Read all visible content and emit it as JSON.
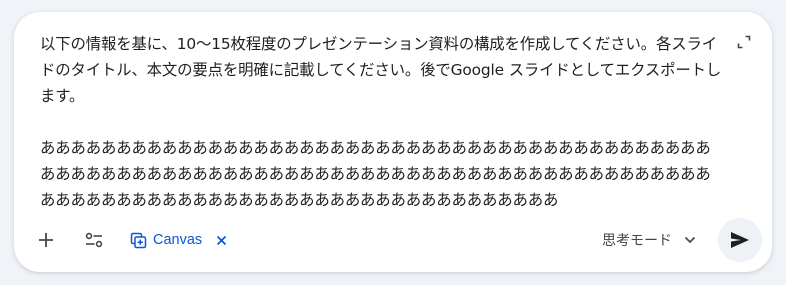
{
  "prompt": {
    "text": "以下の情報を基に、10〜15枚程度のプレゼンテーション資料の構成を作成してください。各スライドのタイトル、本文の要点を明確に記載してください。後でGoogle スライドとしてエクスポートします。\n\nああああああああああああああああああああああああああああああああああああああああああああああああああああああああああああああああああああああああああああああああああああああああああああああああああああああああああああああああああああああああああ"
  },
  "toolbar": {
    "canvas_label": "Canvas",
    "mode_label": "思考モード"
  },
  "icons": {
    "expand": "expand-icon",
    "add": "plus-icon",
    "tools": "tune-icon",
    "canvas": "canvas-icon",
    "close": "close-icon",
    "chevron": "chevron-down-icon",
    "send": "send-icon"
  },
  "colors": {
    "accent": "#0b57d0",
    "text": "#1f1f1f",
    "muted": "#444746",
    "background": "#f0f4f9",
    "send_bg": "#eef2f7"
  }
}
